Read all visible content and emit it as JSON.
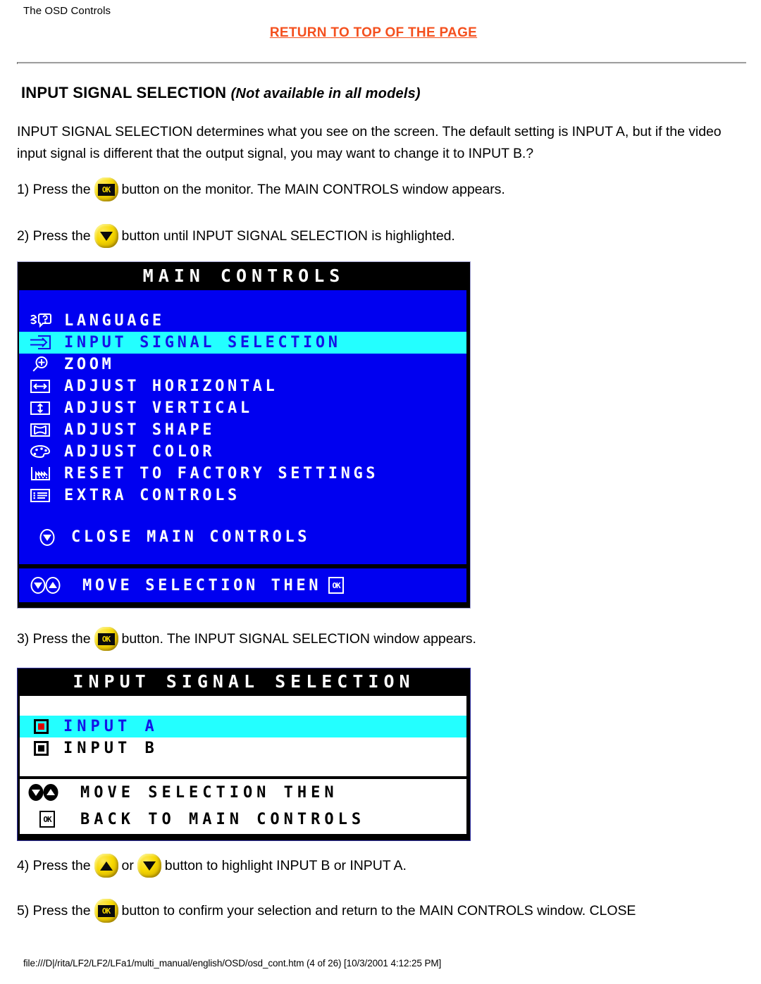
{
  "header": {
    "breadcrumb": "The OSD Controls",
    "return_link": "RETURN TO TOP OF THE PAGE"
  },
  "section": {
    "heading_main": "INPUT SIGNAL SELECTION ",
    "heading_sub": "(Not available in all models)",
    "intro": "INPUT SIGNAL SELECTION determines what you see on the screen. The default setting is INPUT A, but if the video input signal is different that the output signal, you may want to change it to INPUT B.?"
  },
  "steps": {
    "s1_num": "1) Press the",
    "s1_tail": "button on the monitor. The MAIN CONTROLS window appears.",
    "s2_num": "2) Press the",
    "s2_tail": "button until INPUT SIGNAL SELECTION is highlighted.",
    "s3_num": "3) Press the",
    "s3_tail": "button. The INPUT SIGNAL SELECTION window appears.",
    "s4_num": "4) Press the",
    "s4_mid": "or",
    "s4_tail": "button to highlight INPUT B or INPUT A.",
    "s5_num": "5) Press the",
    "s5_tail": "button to confirm your selection and return to the MAIN CONTROLS window. CLOSE"
  },
  "buttons": {
    "ok_label": "OK",
    "ok_icon": "ok-button-icon",
    "down_icon": "down-arrow-button-icon",
    "up_icon": "up-arrow-button-icon"
  },
  "osd_main": {
    "title": "MAIN CONTROLS",
    "items": [
      {
        "icon": "language-icon",
        "label": "LANGUAGE",
        "selected": false
      },
      {
        "icon": "input-signal-icon",
        "label": "INPUT SIGNAL SELECTION",
        "selected": true
      },
      {
        "icon": "zoom-icon",
        "label": "ZOOM",
        "selected": false
      },
      {
        "icon": "adjust-horizontal-icon",
        "label": "ADJUST HORIZONTAL",
        "selected": false
      },
      {
        "icon": "adjust-vertical-icon",
        "label": "ADJUST VERTICAL",
        "selected": false
      },
      {
        "icon": "adjust-shape-icon",
        "label": "ADJUST SHAPE",
        "selected": false
      },
      {
        "icon": "adjust-color-icon",
        "label": "ADJUST COLOR",
        "selected": false
      },
      {
        "icon": "factory-reset-icon",
        "label": "RESET TO FACTORY SETTINGS",
        "selected": false
      },
      {
        "icon": "extra-controls-icon",
        "label": "EXTRA CONTROLS",
        "selected": false
      }
    ],
    "close_label": "CLOSE MAIN CONTROLS",
    "close_icon": "close-down-arrow-icon",
    "hint_label": "MOVE SELECTION THEN",
    "hint_ok": "OK"
  },
  "osd_input": {
    "title": "INPUT SIGNAL SELECTION",
    "options": [
      {
        "label": "INPUT A",
        "selected": true,
        "radio": "radio-selected-icon"
      },
      {
        "label": "INPUT B",
        "selected": false,
        "radio": "radio-unselected-icon"
      }
    ],
    "hint_move": "MOVE SELECTION THEN",
    "hint_back": "BACK TO MAIN CONTROLS",
    "hint_ok": "OK"
  },
  "footer": {
    "path": "file:///D|/rita/LF2/LF2/LFa1/multi_manual/english/OSD/osd_cont.htm (4 of 26) [10/3/2001 4:12:25 PM]"
  },
  "colors": {
    "link": "#f4501e",
    "osd_blue": "#0000f0",
    "osd_highlight": "#23ffff",
    "osd_highlight_text": "#1414e6",
    "button_yellow": "#f7d800",
    "radio_on": "#e00000"
  }
}
